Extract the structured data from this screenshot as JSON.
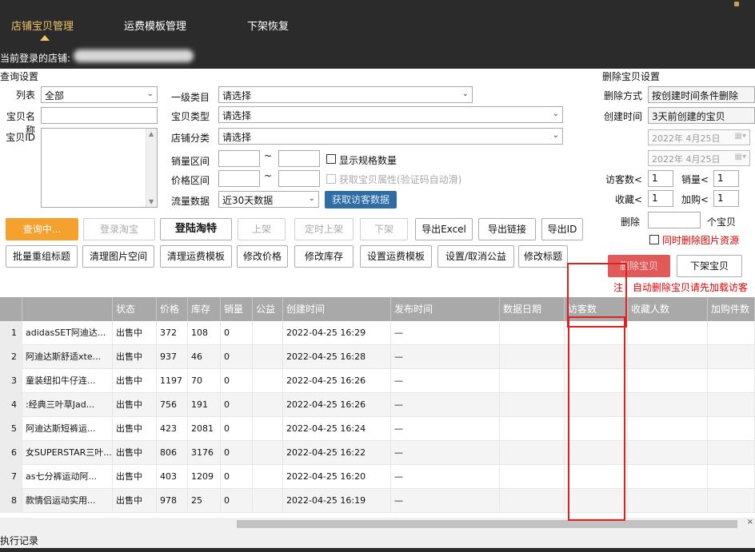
{
  "topbar": {
    "tabs": [
      "店铺宝贝管理",
      "运费模板管理",
      "下架恢复"
    ],
    "login_label": "当前登录的店铺:"
  },
  "query": {
    "title": "查询设置",
    "list_label": "列表",
    "list_value": "全部",
    "name_label": "宝贝名称",
    "id_label": "宝贝ID",
    "cat1_label": "一级类目",
    "cat1_value": "请选择",
    "type_label": "宝贝类型",
    "type_value": "请选择",
    "shopcat_label": "店铺分类",
    "shopcat_value": "请选择",
    "sales_label": "销量区间",
    "price_label": "价格区间",
    "tilde": "~",
    "show_spec": "显示规格数量",
    "get_attr": "获取宝贝属性(验证码自动滑)",
    "traffic_label": "流量数据",
    "traffic_value": "近30天数据",
    "get_visitor": "获取访客数据"
  },
  "buttons_row1": [
    "查询中...",
    "登录淘宝",
    "登陆淘特",
    "上架",
    "定时上架",
    "下架",
    "导出Excel",
    "导出链接",
    "导出ID"
  ],
  "buttons_row2": [
    "批量重组标题",
    "清理图片空间",
    "清理运费模板",
    "修改价格",
    "修改库存",
    "设置运费模板",
    "设置/取消公益",
    "修改标题"
  ],
  "delete": {
    "title": "删除宝贝设置",
    "method_label": "删除方式",
    "method_value": "按创建时间条件删除",
    "created_label": "创建时间",
    "created_value": "3天前创建的宝贝",
    "date1": "2022年 4月25日",
    "date2": "2022年 4月25日",
    "visitor_label": "访客数<",
    "visitor_value": "1",
    "sales_label": "销量<",
    "sales_value": "1",
    "fav_label": "收藏<",
    "fav_value": "1",
    "cart_label": "加购<",
    "cart_value": "1",
    "delete_label": "删除",
    "unit": "个宝贝",
    "also_delete_images": "同时删除图片资源",
    "delete_btn": "删除宝贝",
    "unlist_btn": "下架宝贝",
    "note_prefix": "注",
    "note": "自动删除宝贝请先加载访客"
  },
  "table": {
    "headers": [
      "",
      "",
      "状态",
      "价格",
      "库存",
      "销量",
      "公益",
      "创建时间",
      "发布时间",
      "数据日期",
      "访客数",
      "收藏人数",
      "加购件数"
    ],
    "rows": [
      [
        "1",
        "adidasSET阿迪达...",
        "出售中",
        "372",
        "108",
        "0",
        "",
        "2022-04-25 16:29",
        "—",
        "",
        "",
        "",
        ""
      ],
      [
        "2",
        "阿迪达斯舒适xte...",
        "出售中",
        "937",
        "46",
        "0",
        "",
        "2022-04-25 16:28",
        "—",
        "",
        "",
        "",
        ""
      ],
      [
        "3",
        "童装纽扣牛仔连...",
        "出售中",
        "1197",
        "70",
        "0",
        "",
        "2022-04-25 16:26",
        "—",
        "",
        "",
        "",
        ""
      ],
      [
        "4",
        ":经典三叶草Jad...",
        "出售中",
        "756",
        "191",
        "0",
        "",
        "2022-04-25 16:26",
        "—",
        "",
        "",
        "",
        ""
      ],
      [
        "5",
        "阿迪达斯短裤运...",
        "出售中",
        "423",
        "2081",
        "0",
        "",
        "2022-04-25 16:24",
        "—",
        "",
        "",
        "",
        ""
      ],
      [
        "6",
        "女SUPERSTAR三叶...",
        "出售中",
        "806",
        "3176",
        "0",
        "",
        "2022-04-25 16:22",
        "—",
        "",
        "",
        "",
        ""
      ],
      [
        "7",
        "as七分裤运动阿...",
        "出售中",
        "403",
        "1209",
        "0",
        "",
        "2022-04-25 16:20",
        "—",
        "",
        "",
        "",
        ""
      ],
      [
        "8",
        "款情侣运动实用...",
        "出售中",
        "978",
        "25",
        "0",
        "",
        "2022-04-25 16:19",
        "—",
        "",
        "",
        "",
        ""
      ]
    ]
  },
  "footer": {
    "log_label": "执行记录"
  },
  "colors": {
    "topbar": "#2b2b2b",
    "accent": "#f2c46a",
    "orange": "#f5a12e",
    "header": "#a9a9a9",
    "highlight": "#e02020"
  }
}
